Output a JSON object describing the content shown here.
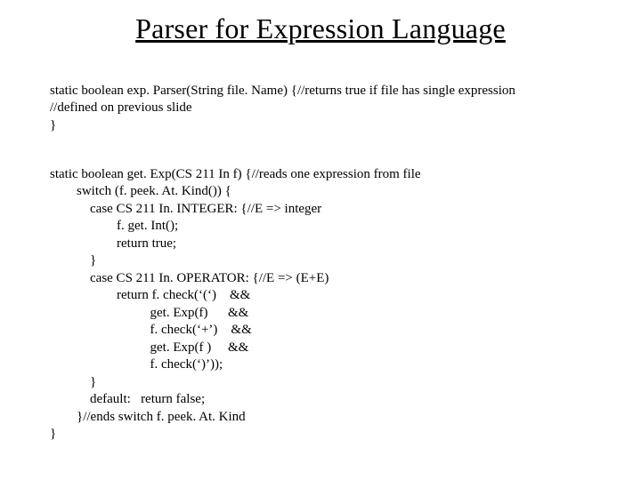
{
  "title": "Parser for Expression Language",
  "block1": {
    "l1": "static boolean exp. Parser(String file. Name) {//returns true if file has single expression",
    "l2": "//defined on previous slide",
    "l3": "}"
  },
  "block2": {
    "l1": "static boolean get. Exp(CS 211 In f) {//reads one expression from file",
    "l2": "        switch (f. peek. At. Kind()) {",
    "l3": "            case CS 211 In. INTEGER: {//E => integer",
    "l4": "                    f. get. Int();",
    "l5": "                    return true;",
    "l6": "            }",
    "l7": "            case CS 211 In. OPERATOR: {//E => (E+E)",
    "l8": "                    return f. check(‘(‘)    &&",
    "l9": "                              get. Exp(f)      &&",
    "l10": "                              f. check(‘+’)    &&",
    "l11": "                              get. Exp(f )     &&",
    "l12": "                              f. check(‘)’));",
    "l13": "            }",
    "l14": "            default:   return false;",
    "l15": "        }//ends switch f. peek. At. Kind",
    "l16": "}"
  }
}
